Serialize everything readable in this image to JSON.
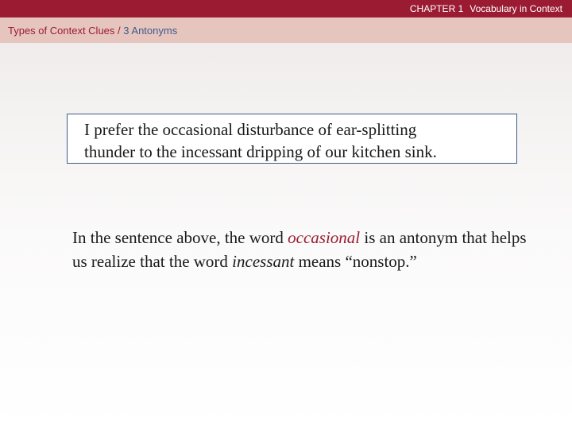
{
  "header": {
    "chapter": "CHAPTER 1",
    "chapter_title": "Vocabulary in Context"
  },
  "breadcrumb": {
    "section": "Types of Context Clues",
    "separator": "/",
    "current": "3 Antonyms"
  },
  "example": {
    "line1": "I prefer the occasional disturbance of ear-splitting",
    "line2": "thunder to the incessant dripping of our kitchen sink."
  },
  "explanation": {
    "part1": "In the sentence above, the word ",
    "term1": "occasional",
    "part2": " is an antonym that helps us realize that the word ",
    "term2": "incessant",
    "part3": " means “nonstop.”"
  },
  "colors": {
    "brand": "#9a1b32",
    "subbar": "#e7c5bf",
    "link_blue": "#3d5a8a",
    "box_border": "#3f5c8a"
  }
}
